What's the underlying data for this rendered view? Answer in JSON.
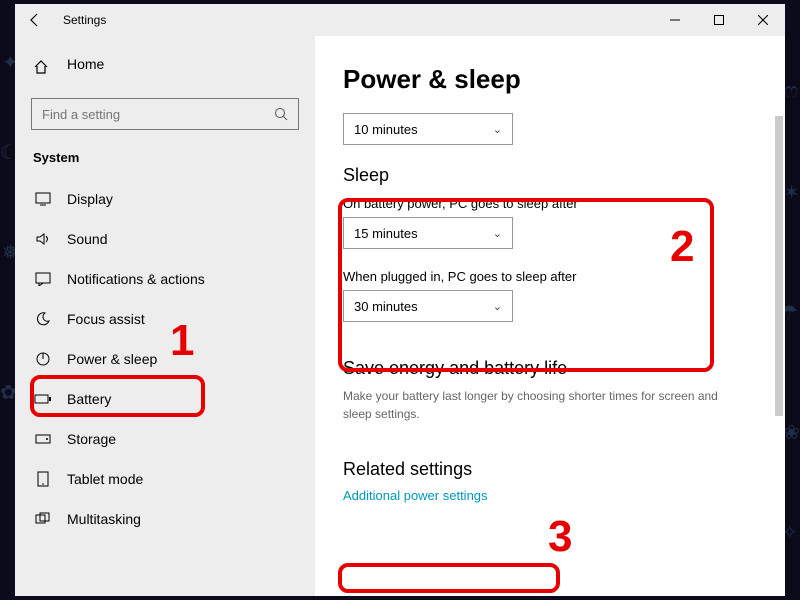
{
  "titlebar": {
    "title": "Settings"
  },
  "sidebar": {
    "home": "Home",
    "search_placeholder": "Find a setting",
    "section": "System",
    "items": [
      {
        "label": "Display"
      },
      {
        "label": "Sound"
      },
      {
        "label": "Notifications & actions"
      },
      {
        "label": "Focus assist"
      },
      {
        "label": "Power & sleep"
      },
      {
        "label": "Battery"
      },
      {
        "label": "Storage"
      },
      {
        "label": "Tablet mode"
      },
      {
        "label": "Multitasking"
      }
    ]
  },
  "content": {
    "title": "Power & sleep",
    "screen_dropdown": "10 minutes",
    "sleep_head": "Sleep",
    "battery_label": "On battery power, PC goes to sleep after",
    "battery_value": "15 minutes",
    "plugged_label": "When plugged in, PC goes to sleep after",
    "plugged_value": "30 minutes",
    "save_title": "Save energy and battery life",
    "save_desc": "Make your battery last longer by choosing shorter times for screen and sleep settings.",
    "related_title": "Related settings",
    "link": "Additional power settings"
  },
  "annotations": {
    "n1": "1",
    "n2": "2",
    "n3": "3"
  }
}
